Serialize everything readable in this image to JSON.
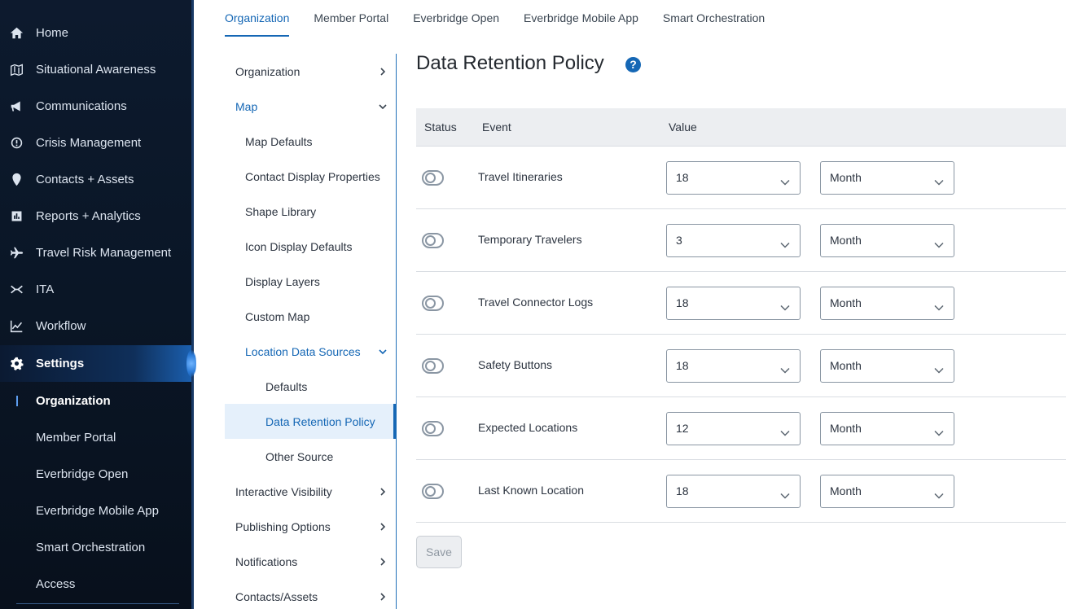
{
  "sidebar": {
    "items": [
      {
        "label": "Home",
        "icon": "home-icon"
      },
      {
        "label": "Situational Awareness",
        "icon": "map-icon"
      },
      {
        "label": "Communications",
        "icon": "megaphone-icon"
      },
      {
        "label": "Crisis Management",
        "icon": "alert-circle-icon"
      },
      {
        "label": "Contacts + Assets",
        "icon": "location-pin-icon"
      },
      {
        "label": "Reports + Analytics",
        "icon": "bar-chart-icon"
      },
      {
        "label": "Travel Risk Management",
        "icon": "airplane-icon"
      },
      {
        "label": "ITA",
        "icon": "ita-icon"
      },
      {
        "label": "Workflow",
        "icon": "line-chart-icon"
      },
      {
        "label": "Settings",
        "icon": "gear-icon"
      }
    ],
    "sub_items": [
      {
        "label": "Organization"
      },
      {
        "label": "Member Portal"
      },
      {
        "label": "Everbridge Open"
      },
      {
        "label": "Everbridge Mobile App"
      },
      {
        "label": "Smart Orchestration"
      },
      {
        "label": "Access"
      }
    ]
  },
  "tabs": [
    {
      "label": "Organization"
    },
    {
      "label": "Member Portal"
    },
    {
      "label": "Everbridge Open"
    },
    {
      "label": "Everbridge Mobile App"
    },
    {
      "label": "Smart Orchestration"
    }
  ],
  "subnav": {
    "items": [
      {
        "label": "Organization"
      },
      {
        "label": "Map"
      },
      {
        "label": "Map Defaults"
      },
      {
        "label": "Contact Display Properties"
      },
      {
        "label": "Shape Library"
      },
      {
        "label": "Icon Display Defaults"
      },
      {
        "label": "Display Layers"
      },
      {
        "label": "Custom Map"
      },
      {
        "label": "Location Data Sources"
      },
      {
        "label": "Defaults"
      },
      {
        "label": "Data Retention Policy"
      },
      {
        "label": "Other Source"
      },
      {
        "label": "Interactive Visibility"
      },
      {
        "label": "Publishing Options"
      },
      {
        "label": "Notifications"
      },
      {
        "label": "Contacts/Assets"
      }
    ]
  },
  "page": {
    "title": "Data Retention Policy",
    "help": "?"
  },
  "table": {
    "headers": {
      "status": "Status",
      "event": "Event",
      "value": "Value"
    },
    "rows": [
      {
        "event": "Travel Itineraries",
        "value": "18",
        "unit": "Month",
        "enabled": false
      },
      {
        "event": "Temporary Travelers",
        "value": "3",
        "unit": "Month",
        "enabled": false
      },
      {
        "event": "Travel Connector Logs",
        "value": "18",
        "unit": "Month",
        "enabled": false
      },
      {
        "event": "Safety Buttons",
        "value": "18",
        "unit": "Month",
        "enabled": false
      },
      {
        "event": "Expected Locations",
        "value": "12",
        "unit": "Month",
        "enabled": false
      },
      {
        "event": "Last Known Location",
        "value": "18",
        "unit": "Month",
        "enabled": false
      }
    ]
  },
  "actions": {
    "save_label": "Save"
  },
  "colors": {
    "accent": "#1567b5",
    "sidebar_bg": "#0d1a2e",
    "selected_bg": "#e5f0fb"
  }
}
